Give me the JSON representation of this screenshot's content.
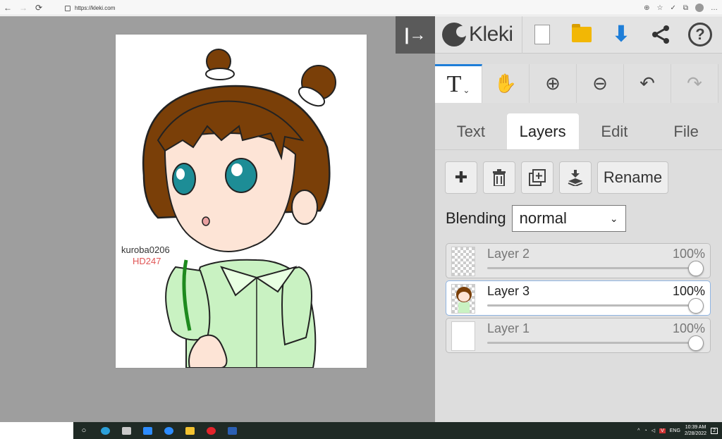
{
  "browser": {
    "url": "https://kleki.com",
    "nav": {
      "back": "←",
      "forward": "→",
      "reload": "⟳"
    },
    "right_icons": [
      "⊕",
      "☆",
      "✓",
      "⧉",
      "…"
    ]
  },
  "canvas": {
    "toggle_ui_glyph": "|→",
    "signature_name": "kuroba0206",
    "signature_id": "HD247"
  },
  "topbar": {
    "logo_text": "Kleki",
    "download_glyph": "⬇",
    "share_glyph": "⋖",
    "help_glyph": "?"
  },
  "tools": [
    {
      "name": "text-tool",
      "glyph": "T",
      "active": true
    },
    {
      "name": "hand-tool",
      "glyph": "✋"
    },
    {
      "name": "zoom-in",
      "glyph": "⊕"
    },
    {
      "name": "zoom-out",
      "glyph": "⊖"
    },
    {
      "name": "undo",
      "glyph": "↶"
    },
    {
      "name": "redo",
      "glyph": "↷"
    }
  ],
  "tabs": [
    {
      "label": "Text",
      "active": false
    },
    {
      "label": "Layers",
      "active": true
    },
    {
      "label": "Edit",
      "active": false
    },
    {
      "label": "File",
      "active": false
    }
  ],
  "layer_buttons": {
    "add": "✚",
    "delete": "🗑",
    "duplicate": "⧉",
    "merge": "⤓",
    "rename": "Rename"
  },
  "blending": {
    "label": "Blending",
    "value": "normal"
  },
  "layers": [
    {
      "name": "Layer 2",
      "opacity_label": "100%",
      "opacity": 1.0,
      "selected": false,
      "thumb": "checker"
    },
    {
      "name": "Layer 3",
      "opacity_label": "100%",
      "opacity": 1.0,
      "selected": true,
      "thumb": "drawing"
    },
    {
      "name": "Layer 1",
      "opacity_label": "100%",
      "opacity": 1.0,
      "selected": false,
      "thumb": "white"
    }
  ],
  "taskbar": {
    "start_glyph": "○",
    "lang": "ENG",
    "time": "10:39 AM",
    "date": "2/28/2022",
    "notif_count": "2",
    "tray_caret": "^"
  }
}
